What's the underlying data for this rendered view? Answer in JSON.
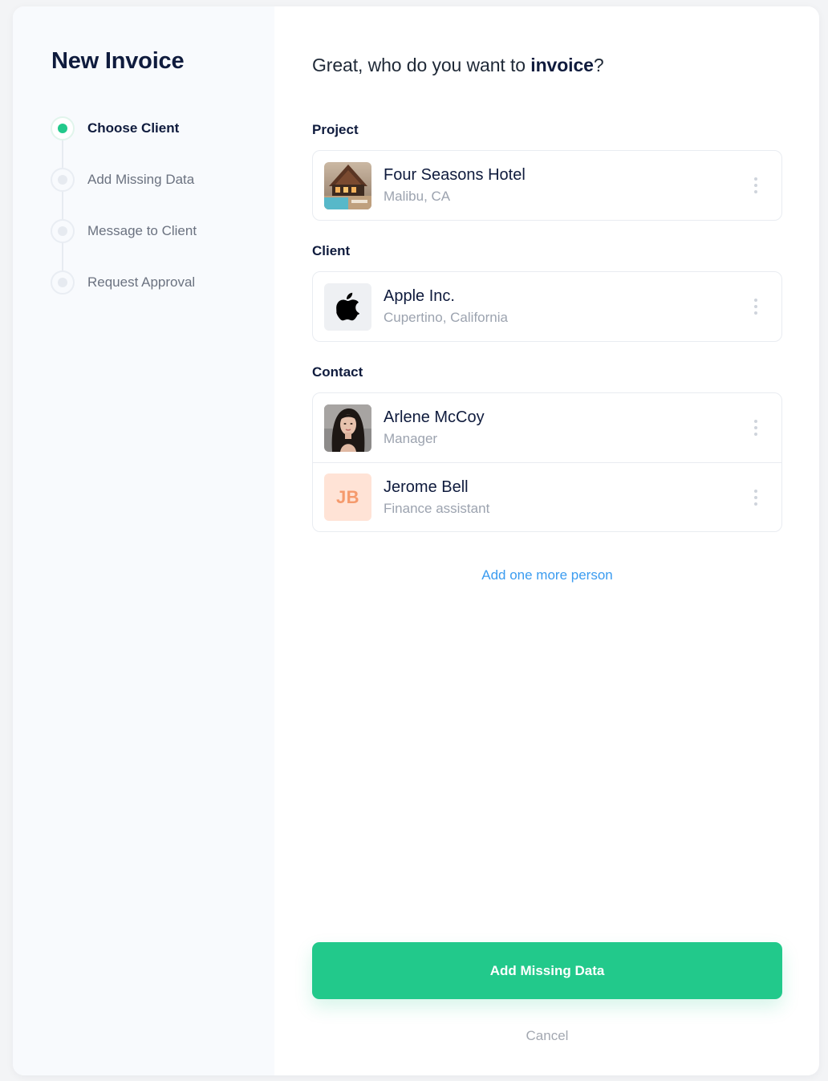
{
  "sidebar": {
    "title": "New Invoice",
    "steps": [
      {
        "label": "Choose Client",
        "active": true
      },
      {
        "label": "Add Missing Data",
        "active": false
      },
      {
        "label": "Message to Client",
        "active": false
      },
      {
        "label": "Request Approval",
        "active": false
      }
    ]
  },
  "main": {
    "heading_prefix": "Great, who do you want to ",
    "heading_bold": "invoice",
    "heading_suffix": "?",
    "project": {
      "section_label": "Project",
      "name": "Four Seasons Hotel",
      "location": "Malibu, CA",
      "icon": "hotel-photo"
    },
    "client": {
      "section_label": "Client",
      "name": "Apple Inc.",
      "location": "Cupertino, California",
      "icon": "apple-logo-icon"
    },
    "contact": {
      "section_label": "Contact",
      "people": [
        {
          "name": "Arlene McCoy",
          "role": "Manager",
          "avatar": "photo"
        },
        {
          "name": "Jerome Bell",
          "role": "Finance assistant",
          "initials": "JB"
        }
      ]
    },
    "add_more_label": "Add one more person",
    "primary_button_label": "Add Missing Data",
    "cancel_label": "Cancel"
  },
  "colors": {
    "accent": "#22c98b",
    "link": "#3b9cf0",
    "title": "#0f1b3d",
    "initials_bg": "#ffe3d6",
    "initials_fg": "#f59a6c"
  }
}
